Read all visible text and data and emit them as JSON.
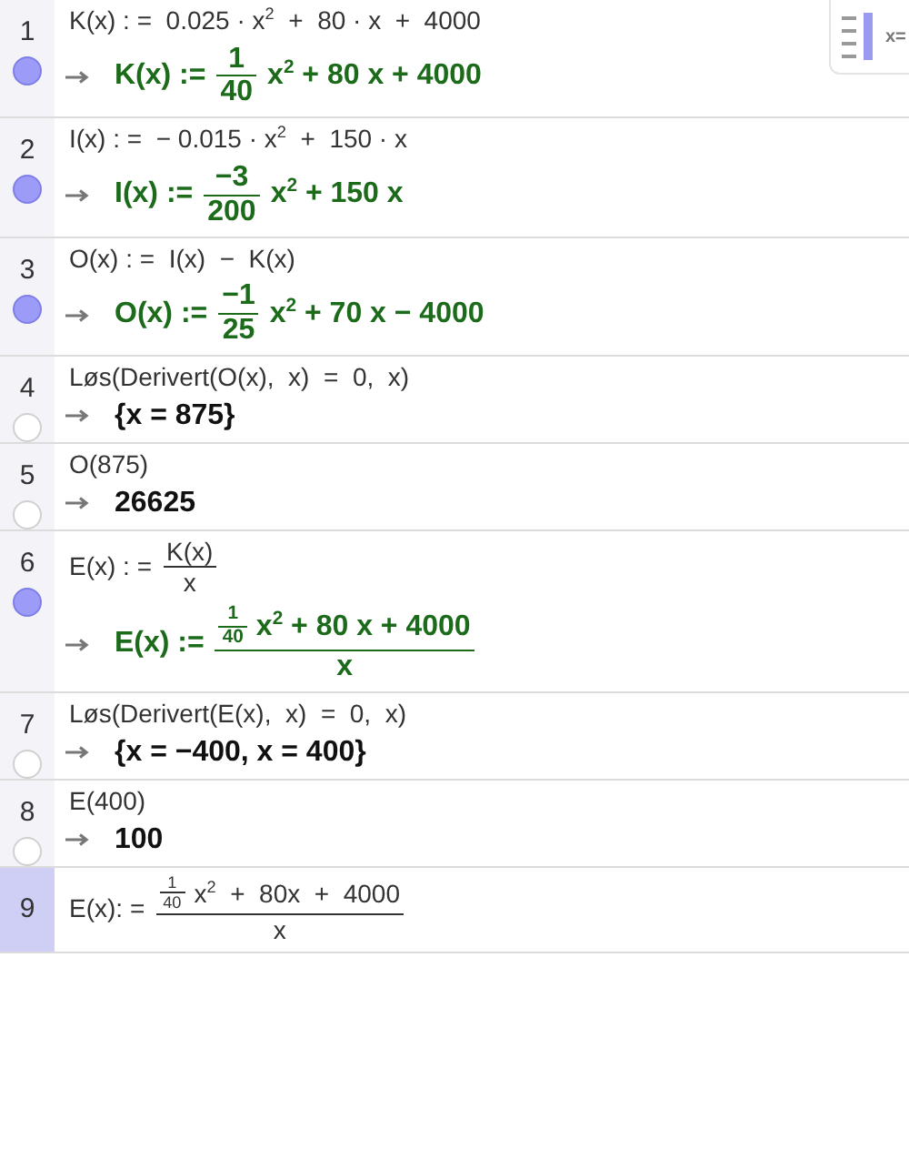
{
  "toggle": {
    "label": "x="
  },
  "rows": [
    {
      "number": "1",
      "selected": false,
      "visible": true,
      "definition": true,
      "input": [
        {
          "kind": "text",
          "text": "K(x) : =  0.025 · x$^{2}$  +  80 · x  +  4000"
        }
      ],
      "output": [
        {
          "kind": "text",
          "text": "K(x) :="
        },
        {
          "kind": "frac",
          "num": [
            {
              "kind": "text",
              "text": "1"
            }
          ],
          "den": [
            {
              "kind": "text",
              "text": "40"
            }
          ]
        },
        {
          "kind": "text",
          "text": "x$^{2}$ + 80 x + 4000"
        }
      ]
    },
    {
      "number": "2",
      "selected": false,
      "visible": true,
      "definition": true,
      "input": [
        {
          "kind": "text",
          "text": "I(x) : =  − 0.015 · x$^{2}$  +  150 · x"
        }
      ],
      "output": [
        {
          "kind": "text",
          "text": "I(x) :="
        },
        {
          "kind": "frac",
          "num": [
            {
              "kind": "text",
              "text": "−3"
            }
          ],
          "den": [
            {
              "kind": "text",
              "text": "200"
            }
          ]
        },
        {
          "kind": "text",
          "text": "x$^{2}$ + 150 x"
        }
      ]
    },
    {
      "number": "3",
      "selected": false,
      "visible": true,
      "definition": true,
      "input": [
        {
          "kind": "text",
          "text": "O(x) : =  I(x)  −  K(x)"
        }
      ],
      "output": [
        {
          "kind": "text",
          "text": "O(x) :="
        },
        {
          "kind": "frac",
          "num": [
            {
              "kind": "text",
              "text": "−1"
            }
          ],
          "den": [
            {
              "kind": "text",
              "text": "25"
            }
          ]
        },
        {
          "kind": "text",
          "text": "x$^{2}$ + 70 x − 4000"
        }
      ]
    },
    {
      "number": "4",
      "selected": false,
      "visible": false,
      "definition": false,
      "input": [
        {
          "kind": "text",
          "text": "Løs(Derivert(O(x),  x)  =  0,  x)"
        }
      ],
      "output": [
        {
          "kind": "text",
          "text": "{x = 875}"
        }
      ]
    },
    {
      "number": "5",
      "selected": false,
      "visible": false,
      "definition": false,
      "input": [
        {
          "kind": "text",
          "text": "O(875)"
        }
      ],
      "output": [
        {
          "kind": "text",
          "text": "26625"
        }
      ]
    },
    {
      "number": "6",
      "selected": false,
      "visible": true,
      "definition": true,
      "input": [
        {
          "kind": "text",
          "text": "E(x) : ="
        },
        {
          "kind": "frac",
          "num": [
            {
              "kind": "text",
              "text": "K(x)"
            }
          ],
          "den": [
            {
              "kind": "text",
              "text": "x"
            }
          ]
        }
      ],
      "output": [
        {
          "kind": "text",
          "text": "E(x) :="
        },
        {
          "kind": "frac",
          "num": [
            {
              "kind": "frac",
              "num": [
                {
                  "kind": "text",
                  "text": "1"
                }
              ],
              "den": [
                {
                  "kind": "text",
                  "text": "40"
                }
              ]
            },
            {
              "kind": "text",
              "text": "x$^{2}$ + 80 x + 4000"
            }
          ],
          "den": [
            {
              "kind": "text",
              "text": "x"
            }
          ]
        }
      ]
    },
    {
      "number": "7",
      "selected": false,
      "visible": false,
      "definition": false,
      "input": [
        {
          "kind": "text",
          "text": "Løs(Derivert(E(x),  x)  =  0,  x)"
        }
      ],
      "output": [
        {
          "kind": "text",
          "text": "{x = −400, x = 400}"
        }
      ]
    },
    {
      "number": "8",
      "selected": false,
      "visible": false,
      "definition": false,
      "input": [
        {
          "kind": "text",
          "text": "E(400)"
        }
      ],
      "output": [
        {
          "kind": "text",
          "text": "100"
        }
      ]
    },
    {
      "number": "9",
      "selected": true,
      "input": [
        {
          "kind": "text",
          "text": "E(x): ="
        },
        {
          "kind": "frac",
          "num": [
            {
              "kind": "frac",
              "num": [
                {
                  "kind": "text",
                  "text": "1"
                }
              ],
              "den": [
                {
                  "kind": "text",
                  "text": "40"
                }
              ]
            },
            {
              "kind": "text",
              "text": "x$^{2}$  +  80x  +  4000"
            }
          ],
          "den": [
            {
              "kind": "text",
              "text": "x"
            }
          ]
        }
      ]
    }
  ]
}
